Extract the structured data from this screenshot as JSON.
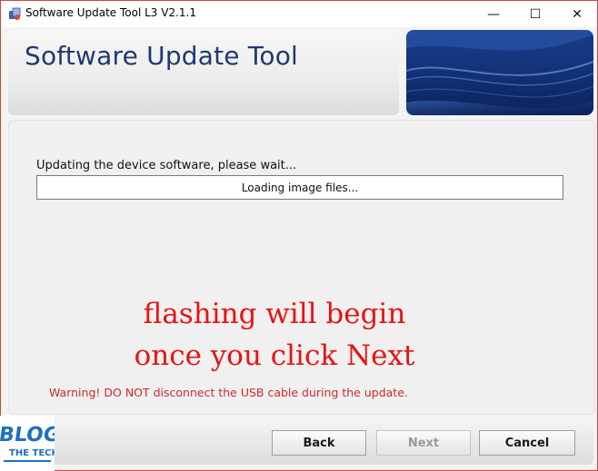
{
  "window": {
    "title": "Software Update Tool L3 V2.1.1",
    "controls": {
      "minimize": "—",
      "maximize": "☐",
      "close": "✕"
    },
    "icon": "app-icon"
  },
  "header": {
    "title": "Software Update Tool"
  },
  "main": {
    "status_label": "Updating the device software, please wait...",
    "progress_text": "Loading image files...",
    "annotation_lines": [
      "flashing will begin",
      "once you click Next"
    ],
    "warning": "Warning! DO NOT disconnect the USB cable during the update."
  },
  "footer": {
    "back_label": "Back",
    "next_label": "Next",
    "cancel_label": "Cancel",
    "next_enabled": false
  },
  "watermark": {
    "text_top": "BLOG",
    "text_bottom": "THE TECH"
  },
  "colors": {
    "accent": "#1e3a72",
    "annotation": "#e81313",
    "warning": "#d02a2a",
    "banner_blue": "#14347b"
  }
}
